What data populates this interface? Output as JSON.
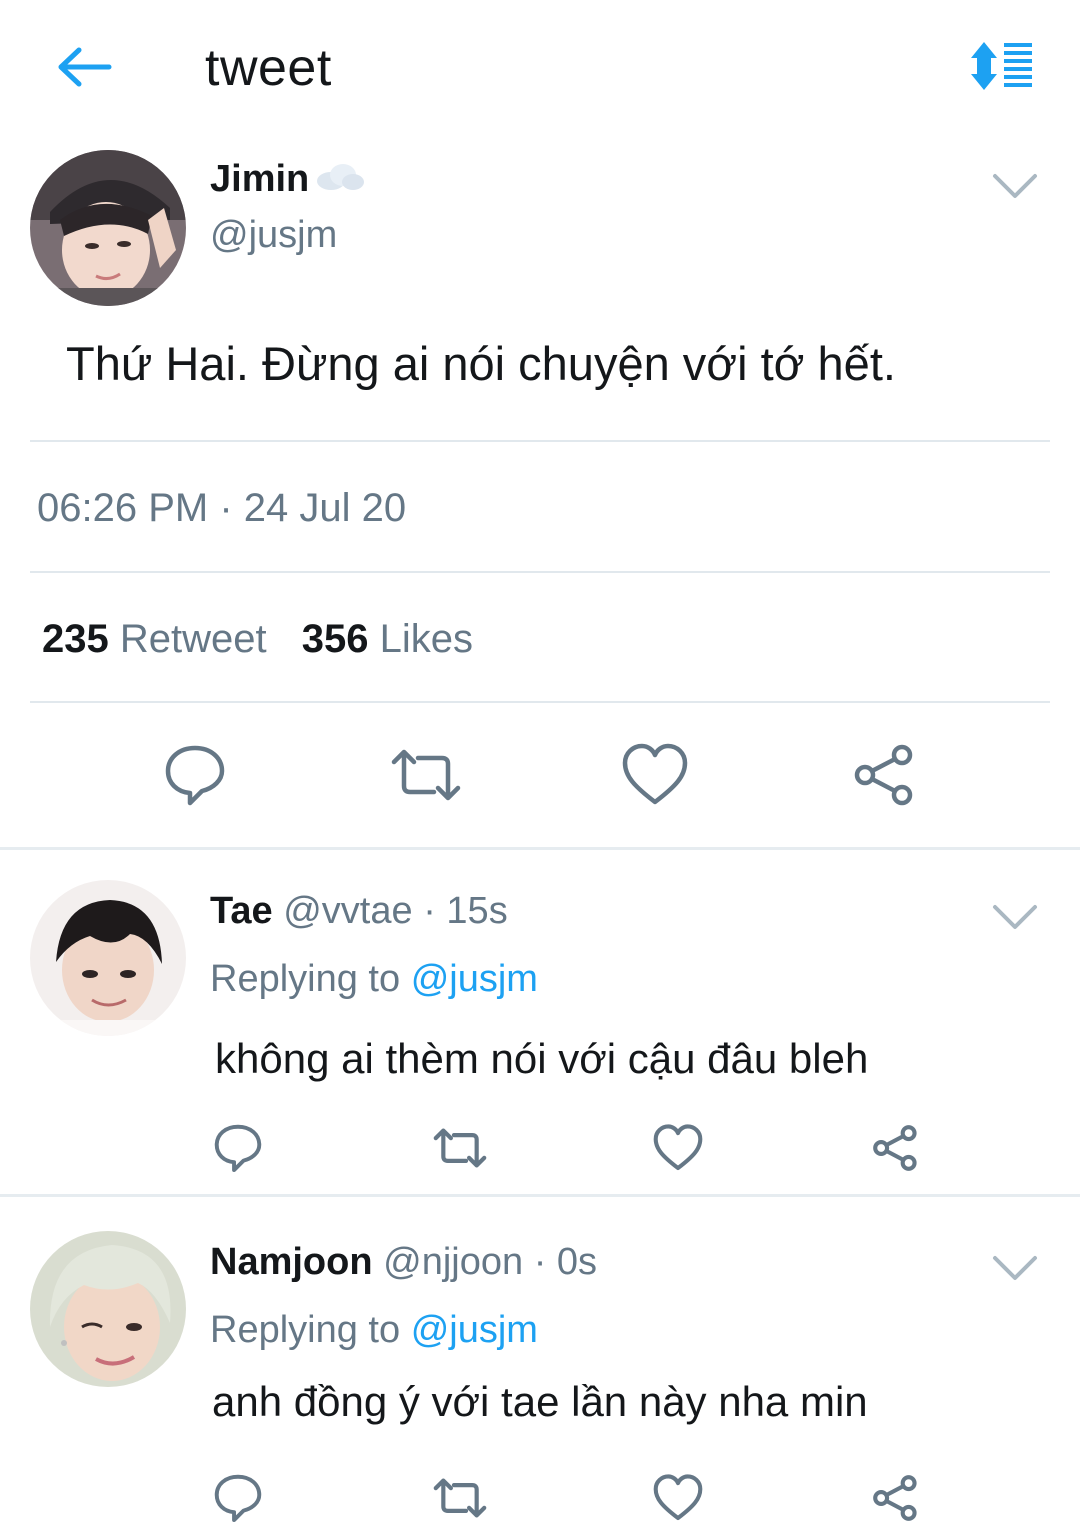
{
  "header": {
    "title": "tweet",
    "back_icon": "arrow-left-icon",
    "sort_icon": "sort-list-icon",
    "accent": "#1da1f2"
  },
  "tweet": {
    "author": {
      "name": "Jimin",
      "handle": "@jusjm"
    },
    "text": "Thứ Hai. Đừng ai nói chuyện với tớ hết.",
    "timestamp": "06:26 PM · 24 Jul 20",
    "stats": {
      "retweets": "235",
      "retweets_label": "Retweet",
      "likes": "356",
      "likes_label": "Likes"
    }
  },
  "replies": [
    {
      "name": "Tae",
      "handle": "@vvtae",
      "separator": "·",
      "time": "15s",
      "replying_label": "Replying to",
      "replying_to": "@jusjm",
      "text": "không ai thèm nói với cậu đâu bleh"
    },
    {
      "name": "Namjoon",
      "handle": "@njjoon",
      "separator": "·",
      "time": "0s",
      "replying_label": "Replying to",
      "replying_to": "@jusjm",
      "text": "anh đồng ý với tae lần này nha min"
    }
  ],
  "colors": {
    "text": "#14171a",
    "secondary": "#657786",
    "divider": "#e1e8ed",
    "icon": "#657786",
    "link": "#1da1f2"
  }
}
